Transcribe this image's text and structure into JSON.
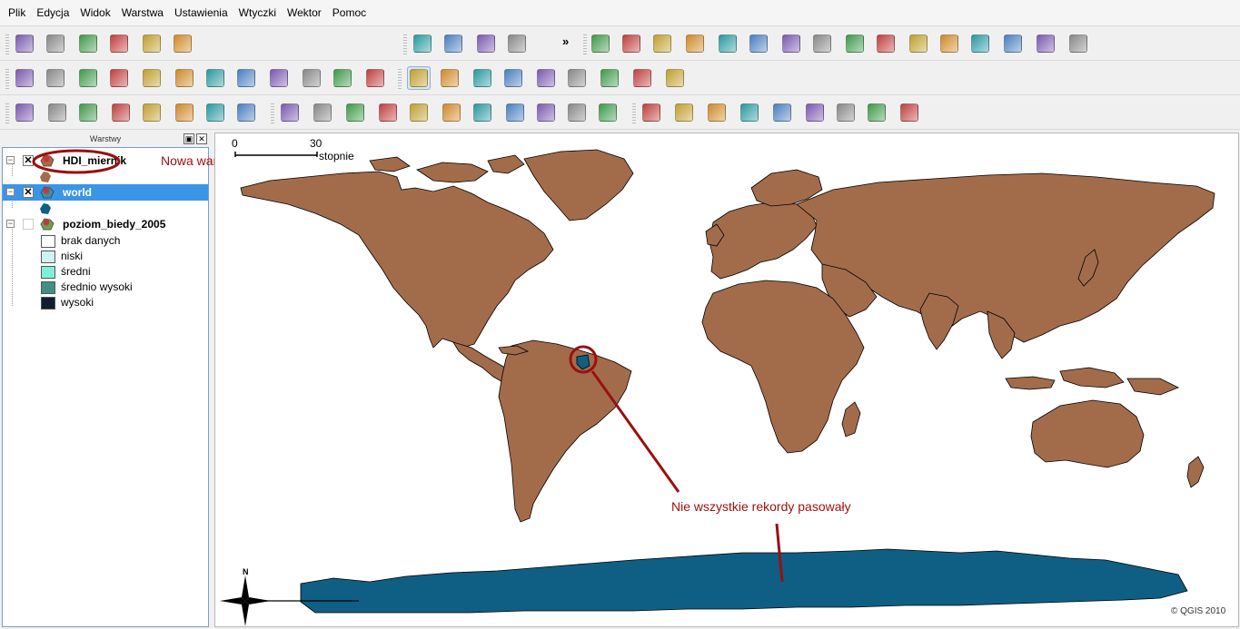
{
  "menu": [
    "Plik",
    "Edycja",
    "Widok",
    "Warstwa",
    "Ustawienia",
    "Wtyczki",
    "Wektor",
    "Pomoc"
  ],
  "toolbar": {
    "overflow_label": "»",
    "row1_icons": [
      "new-project-icon",
      "open-project-icon",
      "save-project-icon",
      "save-as-icon",
      "print-composer-icon",
      "print-icon",
      "add-vector-layer-icon",
      "add-raster-layer-icon",
      "add-postgis-layer-icon",
      "add-spatialite-layer-icon",
      "copyright-label-icon",
      "table-icon",
      "d2s-icon",
      "raster-export-icon",
      "vd-icon",
      "image-icon",
      "globe-icon",
      "histogram-icon",
      "north-arrow-icon",
      "osm-icon",
      "database-icon",
      "pdf-icon",
      "chart-icon",
      "scale-bar-icon",
      "tractor-icon",
      "map-image-icon"
    ],
    "row2_icons": [
      "identify-icon",
      "select-icon",
      "deselect-icon",
      "attribute-table-icon",
      "measure-line-icon",
      "measure-area-icon",
      "measure-angle-icon",
      "map-tips-icon",
      "new-bookmark-icon",
      "show-bookmarks-icon",
      "label-icon",
      "text-annotation-icon",
      "pan-icon",
      "zoom-in-icon",
      "zoom-out-icon",
      "zoom-full-icon",
      "zoom-selection-icon",
      "zoom-layer-icon",
      "zoom-last-icon",
      "zoom-next-icon",
      "refresh-icon"
    ],
    "row3_icons": [
      "toggle-editing-icon",
      "save-edits-icon",
      "move-feature-icon",
      "node-tool-icon",
      "delete-selected-icon",
      "cut-icon",
      "copy-icon",
      "paste-icon",
      "undo-icon",
      "redo-icon",
      "simplify-icon",
      "add-ring-icon",
      "add-part-icon",
      "delete-ring-icon",
      "delete-part-icon",
      "reshape-icon",
      "split-icon",
      "merge-icon",
      "rotate-icon",
      "grass-open-icon",
      "grass-new-icon",
      "grass-close-icon",
      "grass-region-icon",
      "grass-add-icon",
      "grass-tools-icon",
      "grass-edit-icon",
      "grass-vector-icon",
      "grass-raster-icon"
    ]
  },
  "layers_panel": {
    "title": "Warstwy",
    "layers": [
      {
        "name": "HDI_miernik",
        "checked": true,
        "selected": false
      },
      {
        "name": "world",
        "checked": true,
        "selected": true
      },
      {
        "name": "poziom_biedy_2005",
        "checked": false,
        "selected": false
      }
    ],
    "legend_classes": [
      {
        "label": "brak danych",
        "color": "#ffffff"
      },
      {
        "label": "niski",
        "color": "#cdf4ef"
      },
      {
        "label": "średni",
        "color": "#7ff0d8"
      },
      {
        "label": "średnio wysoki",
        "color": "#3f8f82"
      },
      {
        "label": "wysoki",
        "color": "#0f1f2e"
      }
    ]
  },
  "map": {
    "scale_start": "0",
    "scale_end": "30",
    "scale_unit": "stopnie",
    "north_label": "N",
    "copyright": "© QGIS 2010",
    "land_color": "#a26c4b",
    "highlight_color": "#0f5f84"
  },
  "annotations": {
    "new_layer": "Nowa warstwa",
    "mismatch": "Nie wszystkie rekordy pasowały",
    "color": "#a01010"
  }
}
